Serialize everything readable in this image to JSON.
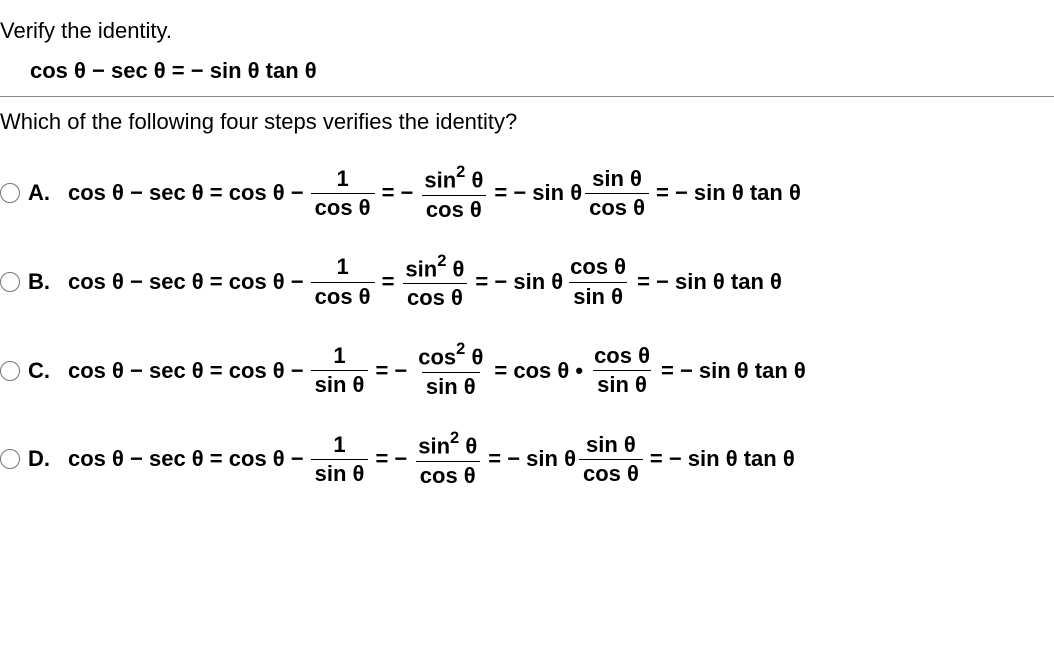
{
  "instruction": "Verify the identity.",
  "identity": "cos θ − sec θ = − sin θ tan θ",
  "question": "Which of the following four steps verifies the identity?",
  "options": {
    "A": {
      "letter": "A.",
      "prefix": "cos θ − sec θ = cos θ −",
      "f1num": "1",
      "f1den": "cos θ",
      "eq1": "= −",
      "f2num": "sin² θ",
      "f2den": "cos θ",
      "eq2": "= − sin θ",
      "f3num": "sin θ",
      "f3den": "cos θ",
      "rhs": "= − sin θ tan θ"
    },
    "B": {
      "letter": "B.",
      "prefix": "cos θ − sec θ = cos θ −",
      "f1num": "1",
      "f1den": "cos θ",
      "eq1": "=",
      "f2num": "sin² θ",
      "f2den": "cos θ",
      "eq2": "= − sin θ",
      "f3num": "cos θ",
      "f3den": "sin θ",
      "rhs": "= − sin θ tan θ"
    },
    "C": {
      "letter": "C.",
      "prefix": "cos θ − sec θ = cos θ −",
      "f1num": "1",
      "f1den": "sin θ",
      "eq1": "= −",
      "f2num": "cos² θ",
      "f2den": "sin θ",
      "eq2": "= cos θ •",
      "f3num": "cos θ",
      "f3den": "sin θ",
      "rhs": "= − sin θ tan θ"
    },
    "D": {
      "letter": "D.",
      "prefix": "cos θ − sec θ = cos θ −",
      "f1num": "1",
      "f1den": "sin θ",
      "eq1": "= −",
      "f2num": "sin² θ",
      "f2den": "cos θ",
      "eq2": "= − sin θ",
      "f3num": "sin θ",
      "f3den": "cos θ",
      "rhs": "= − sin θ tan θ"
    }
  }
}
